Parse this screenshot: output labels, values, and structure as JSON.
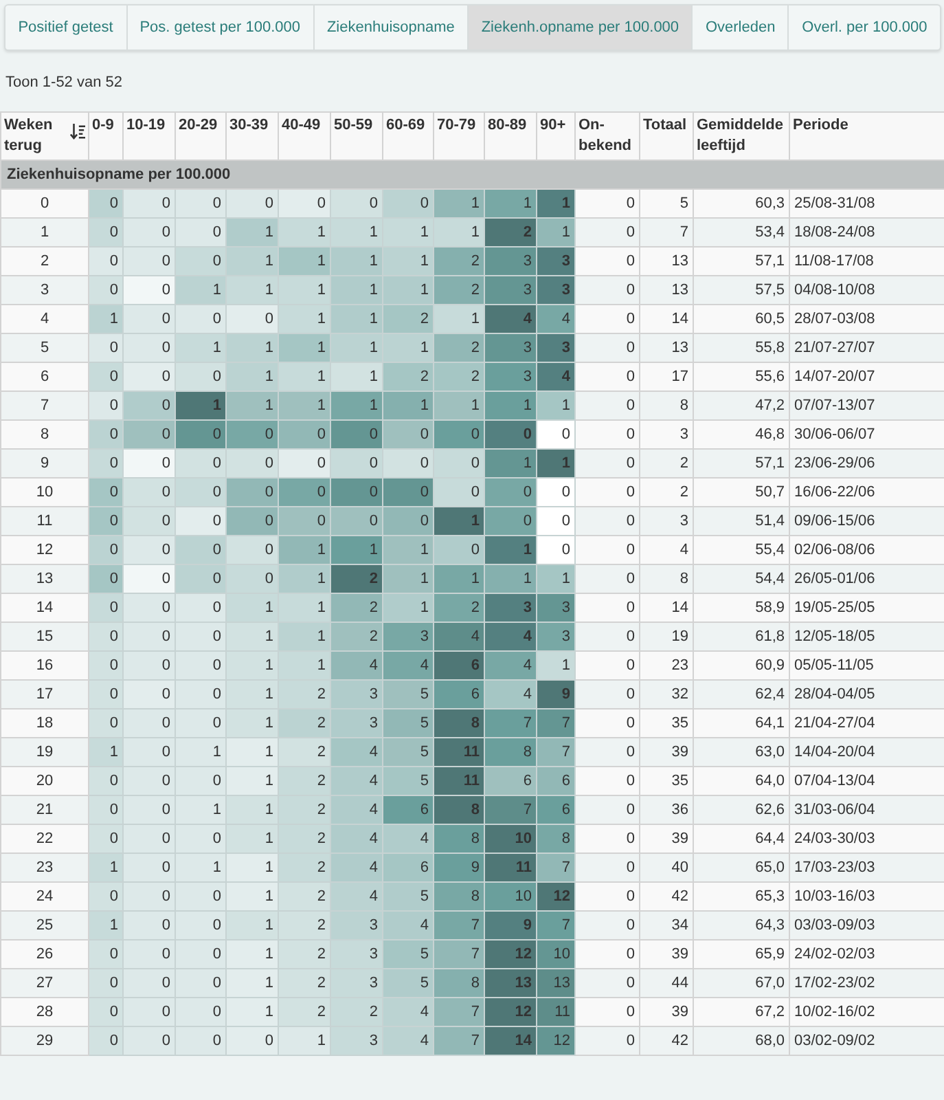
{
  "tabs": [
    {
      "label": "Positief getest",
      "selected": false
    },
    {
      "label": "Pos. getest per 100.000",
      "selected": false
    },
    {
      "label": "Ziekenhuisopname",
      "selected": false
    },
    {
      "label": "Ziekenh.opname per 100.000",
      "selected": true
    },
    {
      "label": "Overleden",
      "selected": false
    },
    {
      "label": "Overl. per 100.000",
      "selected": false
    }
  ],
  "summary": "Toon 1-52 van 52",
  "table": {
    "columns": [
      {
        "label": "Weken terug",
        "kind": "sort"
      },
      {
        "label": "0-9",
        "kind": "plain"
      },
      {
        "label": "10-19",
        "kind": "plain"
      },
      {
        "label": "20-29",
        "kind": "plain"
      },
      {
        "label": "30-39",
        "kind": "plain"
      },
      {
        "label": "40-49",
        "kind": "plain"
      },
      {
        "label": "50-59",
        "kind": "plain"
      },
      {
        "label": "60-69",
        "kind": "plain"
      },
      {
        "label": "70-79",
        "kind": "plain"
      },
      {
        "label": "80-89",
        "kind": "plain"
      },
      {
        "label": "90+",
        "kind": "plain"
      },
      {
        "label": "On-bekend",
        "kind": "plain"
      },
      {
        "label": "Totaal",
        "kind": "plain"
      },
      {
        "label": "Gemiddelde leeftijd",
        "kind": "plain"
      },
      {
        "label": "Periode",
        "kind": "plain"
      }
    ],
    "group": "Ziekenhuisopname per 100.000",
    "rows": [
      {
        "cells": [
          {
            "value": "0"
          },
          {
            "value": "0",
            "color": "#bbd3d2"
          },
          {
            "value": "0",
            "color": "#dde9e9"
          },
          {
            "value": "0",
            "color": "#dde9e9"
          },
          {
            "value": "0",
            "color": "#dde9e9"
          },
          {
            "value": "0",
            "color": "#e3eded"
          },
          {
            "value": "0",
            "color": "#d2e2e1"
          },
          {
            "value": "0",
            "color": "#bbd3d2"
          },
          {
            "value": "1",
            "color": "#92b8b6"
          },
          {
            "value": "1",
            "color": "#78a8a5"
          },
          {
            "value": "1",
            "color": "#548080"
          },
          {
            "value": "0"
          },
          {
            "value": "5"
          },
          {
            "value": "60,3"
          },
          {
            "value": "25/08-31/08"
          }
        ]
      },
      {
        "cells": [
          {
            "value": "1"
          },
          {
            "value": "0",
            "color": "#c7dbda"
          },
          {
            "value": "0",
            "color": "#dde9e9"
          },
          {
            "value": "0",
            "color": "#dde9e9"
          },
          {
            "value": "1",
            "color": "#b0cccb"
          },
          {
            "value": "1",
            "color": "#c7dbda"
          },
          {
            "value": "1",
            "color": "#c7dbda"
          },
          {
            "value": "1",
            "color": "#c7dbda"
          },
          {
            "value": "1",
            "color": "#c7dbda"
          },
          {
            "value": "2",
            "color": "#4f7776"
          },
          {
            "value": "1",
            "color": "#92b8b6"
          },
          {
            "value": "0"
          },
          {
            "value": "7"
          },
          {
            "value": "53,4"
          },
          {
            "value": "18/08-24/08"
          }
        ]
      },
      {
        "cells": [
          {
            "value": "2"
          },
          {
            "value": "0",
            "color": "#dde9e9"
          },
          {
            "value": "0",
            "color": "#dde9e9"
          },
          {
            "value": "0",
            "color": "#c7dbda"
          },
          {
            "value": "1",
            "color": "#bbd3d2"
          },
          {
            "value": "1",
            "color": "#a5c6c4"
          },
          {
            "value": "1",
            "color": "#b0cccb"
          },
          {
            "value": "1",
            "color": "#bbd3d2"
          },
          {
            "value": "2",
            "color": "#85b0ae"
          },
          {
            "value": "3",
            "color": "#649693"
          },
          {
            "value": "3",
            "color": "#548080"
          },
          {
            "value": "0"
          },
          {
            "value": "13"
          },
          {
            "value": "57,1"
          },
          {
            "value": "11/08-17/08"
          }
        ]
      },
      {
        "cells": [
          {
            "value": "3"
          },
          {
            "value": "0",
            "color": "#d2e2e1"
          },
          {
            "value": "0",
            "color": "#f2f7f7"
          },
          {
            "value": "1",
            "color": "#bbd3d2"
          },
          {
            "value": "1",
            "color": "#c7dbda"
          },
          {
            "value": "1",
            "color": "#c7dbda"
          },
          {
            "value": "1",
            "color": "#b0cccb"
          },
          {
            "value": "1",
            "color": "#b0cccb"
          },
          {
            "value": "2",
            "color": "#85b0ae"
          },
          {
            "value": "3",
            "color": "#649693"
          },
          {
            "value": "3",
            "color": "#548080"
          },
          {
            "value": "0"
          },
          {
            "value": "13"
          },
          {
            "value": "57,5"
          },
          {
            "value": "04/08-10/08"
          }
        ]
      },
      {
        "cells": [
          {
            "value": "4"
          },
          {
            "value": "1",
            "color": "#bbd3d2"
          },
          {
            "value": "0",
            "color": "#dde9e9"
          },
          {
            "value": "0",
            "color": "#dde9e9"
          },
          {
            "value": "0",
            "color": "#e3eded"
          },
          {
            "value": "1",
            "color": "#c7dbda"
          },
          {
            "value": "1",
            "color": "#b0cccb"
          },
          {
            "value": "2",
            "color": "#a5c6c4"
          },
          {
            "value": "1",
            "color": "#c7dbda"
          },
          {
            "value": "4",
            "color": "#4f7776"
          },
          {
            "value": "4",
            "color": "#78a8a5"
          },
          {
            "value": "0"
          },
          {
            "value": "14"
          },
          {
            "value": "60,5"
          },
          {
            "value": "28/07-03/08"
          }
        ]
      },
      {
        "cells": [
          {
            "value": "5"
          },
          {
            "value": "0",
            "color": "#dde9e9"
          },
          {
            "value": "0",
            "color": "#dde9e9"
          },
          {
            "value": "1",
            "color": "#c7dbda"
          },
          {
            "value": "1",
            "color": "#bbd3d2"
          },
          {
            "value": "1",
            "color": "#a5c6c4"
          },
          {
            "value": "1",
            "color": "#bbd3d2"
          },
          {
            "value": "1",
            "color": "#bbd3d2"
          },
          {
            "value": "2",
            "color": "#92b8b6"
          },
          {
            "value": "3",
            "color": "#649693"
          },
          {
            "value": "3",
            "color": "#548080"
          },
          {
            "value": "0"
          },
          {
            "value": "13"
          },
          {
            "value": "55,8"
          },
          {
            "value": "21/07-27/07"
          }
        ]
      },
      {
        "cells": [
          {
            "value": "6"
          },
          {
            "value": "0",
            "color": "#c7dbda"
          },
          {
            "value": "0",
            "color": "#e3eded"
          },
          {
            "value": "0",
            "color": "#d2e2e1"
          },
          {
            "value": "1",
            "color": "#bbd3d2"
          },
          {
            "value": "1",
            "color": "#c7dbda"
          },
          {
            "value": "1",
            "color": "#d2e2e1"
          },
          {
            "value": "2",
            "color": "#a5c6c4"
          },
          {
            "value": "2",
            "color": "#a5c6c4"
          },
          {
            "value": "3",
            "color": "#6a9f9c"
          },
          {
            "value": "4",
            "color": "#548080"
          },
          {
            "value": "0"
          },
          {
            "value": "17"
          },
          {
            "value": "55,6"
          },
          {
            "value": "14/07-20/07"
          }
        ]
      },
      {
        "cells": [
          {
            "value": "7"
          },
          {
            "value": "0",
            "color": "#dde9e9"
          },
          {
            "value": "0",
            "color": "#b0cccb"
          },
          {
            "value": "1",
            "color": "#4f7776"
          },
          {
            "value": "1",
            "color": "#9fc0be"
          },
          {
            "value": "1",
            "color": "#9fc0be"
          },
          {
            "value": "1",
            "color": "#78a8a5"
          },
          {
            "value": "1",
            "color": "#85b0ae"
          },
          {
            "value": "1",
            "color": "#9fc0be"
          },
          {
            "value": "1",
            "color": "#6a9f9c"
          },
          {
            "value": "1",
            "color": "#a5c6c4"
          },
          {
            "value": "0"
          },
          {
            "value": "8"
          },
          {
            "value": "47,2"
          },
          {
            "value": "07/07-13/07"
          }
        ]
      },
      {
        "cells": [
          {
            "value": "8"
          },
          {
            "value": "0",
            "color": "#bbd3d2"
          },
          {
            "value": "0",
            "color": "#9fc0be"
          },
          {
            "value": "0",
            "color": "#649693"
          },
          {
            "value": "0",
            "color": "#78a8a5"
          },
          {
            "value": "0",
            "color": "#92b8b6"
          },
          {
            "value": "0",
            "color": "#649693"
          },
          {
            "value": "0",
            "color": "#9fc0be"
          },
          {
            "value": "0",
            "color": "#6a9f9c"
          },
          {
            "value": "0",
            "color": "#548080"
          },
          {
            "value": "0",
            "color": "#ffffff"
          },
          {
            "value": "0"
          },
          {
            "value": "3"
          },
          {
            "value": "46,8"
          },
          {
            "value": "30/06-06/07"
          }
        ]
      },
      {
        "cells": [
          {
            "value": "9"
          },
          {
            "value": "0",
            "color": "#c7dbda"
          },
          {
            "value": "0",
            "color": "#f2f7f7"
          },
          {
            "value": "0",
            "color": "#d2e2e1"
          },
          {
            "value": "0",
            "color": "#d2e2e1"
          },
          {
            "value": "0",
            "color": "#e3eded"
          },
          {
            "value": "0",
            "color": "#c7dbda"
          },
          {
            "value": "0",
            "color": "#d2e2e1"
          },
          {
            "value": "0",
            "color": "#c7dbda"
          },
          {
            "value": "1",
            "color": "#649693"
          },
          {
            "value": "1",
            "color": "#4f7776"
          },
          {
            "value": "0"
          },
          {
            "value": "2"
          },
          {
            "value": "57,1"
          },
          {
            "value": "23/06-29/06"
          }
        ]
      },
      {
        "cells": [
          {
            "value": "10"
          },
          {
            "value": "0",
            "color": "#a5c6c4"
          },
          {
            "value": "0",
            "color": "#d2e2e1"
          },
          {
            "value": "0",
            "color": "#c7dbda"
          },
          {
            "value": "0",
            "color": "#92b8b6"
          },
          {
            "value": "0",
            "color": "#78a8a5"
          },
          {
            "value": "0",
            "color": "#649693"
          },
          {
            "value": "0",
            "color": "#649693"
          },
          {
            "value": "0",
            "color": "#c7dbda"
          },
          {
            "value": "0",
            "color": "#78a8a5"
          },
          {
            "value": "0",
            "color": "#ffffff"
          },
          {
            "value": "0"
          },
          {
            "value": "2"
          },
          {
            "value": "50,7"
          },
          {
            "value": "16/06-22/06"
          }
        ]
      },
      {
        "cells": [
          {
            "value": "11"
          },
          {
            "value": "0",
            "color": "#a5c6c4"
          },
          {
            "value": "0",
            "color": "#d2e2e1"
          },
          {
            "value": "0",
            "color": "#e3eded"
          },
          {
            "value": "0",
            "color": "#92b8b6"
          },
          {
            "value": "0",
            "color": "#9fc0be"
          },
          {
            "value": "0",
            "color": "#9fc0be"
          },
          {
            "value": "0",
            "color": "#92b8b6"
          },
          {
            "value": "1",
            "color": "#4f7776"
          },
          {
            "value": "0",
            "color": "#78a8a5"
          },
          {
            "value": "0",
            "color": "#ffffff"
          },
          {
            "value": "0"
          },
          {
            "value": "3"
          },
          {
            "value": "51,4"
          },
          {
            "value": "09/06-15/06"
          }
        ]
      },
      {
        "cells": [
          {
            "value": "12"
          },
          {
            "value": "0",
            "color": "#bbd3d2"
          },
          {
            "value": "0",
            "color": "#dde9e9"
          },
          {
            "value": "0",
            "color": "#bbd3d2"
          },
          {
            "value": "0",
            "color": "#d2e2e1"
          },
          {
            "value": "1",
            "color": "#92b8b6"
          },
          {
            "value": "1",
            "color": "#6a9f9c"
          },
          {
            "value": "1",
            "color": "#9fc0be"
          },
          {
            "value": "0",
            "color": "#b0cccb"
          },
          {
            "value": "1",
            "color": "#548080"
          },
          {
            "value": "0",
            "color": "#ffffff"
          },
          {
            "value": "0"
          },
          {
            "value": "4"
          },
          {
            "value": "55,4"
          },
          {
            "value": "02/06-08/06"
          }
        ]
      },
      {
        "cells": [
          {
            "value": "13"
          },
          {
            "value": "0",
            "color": "#a5c6c4"
          },
          {
            "value": "0",
            "color": "#f2f7f7"
          },
          {
            "value": "0",
            "color": "#bbd3d2"
          },
          {
            "value": "0",
            "color": "#c7dbda"
          },
          {
            "value": "1",
            "color": "#b0cccb"
          },
          {
            "value": "2",
            "color": "#4f7776"
          },
          {
            "value": "1",
            "color": "#9fc0be"
          },
          {
            "value": "1",
            "color": "#78a8a5"
          },
          {
            "value": "1",
            "color": "#85b0ae"
          },
          {
            "value": "1",
            "color": "#a5c6c4"
          },
          {
            "value": "0"
          },
          {
            "value": "8"
          },
          {
            "value": "54,4"
          },
          {
            "value": "26/05-01/06"
          }
        ]
      },
      {
        "cells": [
          {
            "value": "14"
          },
          {
            "value": "0",
            "color": "#c7dbda"
          },
          {
            "value": "0",
            "color": "#dde9e9"
          },
          {
            "value": "0",
            "color": "#dde9e9"
          },
          {
            "value": "1",
            "color": "#c7dbda"
          },
          {
            "value": "1",
            "color": "#c7dbda"
          },
          {
            "value": "2",
            "color": "#92b8b6"
          },
          {
            "value": "1",
            "color": "#b0cccb"
          },
          {
            "value": "2",
            "color": "#78a8a5"
          },
          {
            "value": "3",
            "color": "#548080"
          },
          {
            "value": "3",
            "color": "#649693"
          },
          {
            "value": "0"
          },
          {
            "value": "14"
          },
          {
            "value": "58,9"
          },
          {
            "value": "19/05-25/05"
          }
        ]
      },
      {
        "cells": [
          {
            "value": "15"
          },
          {
            "value": "0",
            "color": "#d2e2e1"
          },
          {
            "value": "0",
            "color": "#dde9e9"
          },
          {
            "value": "0",
            "color": "#dde9e9"
          },
          {
            "value": "1",
            "color": "#d2e2e1"
          },
          {
            "value": "1",
            "color": "#bbd3d2"
          },
          {
            "value": "2",
            "color": "#9fc0be"
          },
          {
            "value": "3",
            "color": "#78a8a5"
          },
          {
            "value": "4",
            "color": "#5e8d8a"
          },
          {
            "value": "4",
            "color": "#548080"
          },
          {
            "value": "3",
            "color": "#78a8a5"
          },
          {
            "value": "0"
          },
          {
            "value": "19"
          },
          {
            "value": "61,8"
          },
          {
            "value": "12/05-18/05"
          }
        ]
      },
      {
        "cells": [
          {
            "value": "16"
          },
          {
            "value": "0",
            "color": "#d2e2e1"
          },
          {
            "value": "0",
            "color": "#dde9e9"
          },
          {
            "value": "0",
            "color": "#dde9e9"
          },
          {
            "value": "1",
            "color": "#d2e2e1"
          },
          {
            "value": "1",
            "color": "#c7dbda"
          },
          {
            "value": "4",
            "color": "#92b8b6"
          },
          {
            "value": "4",
            "color": "#78a8a5"
          },
          {
            "value": "6",
            "color": "#4f7776"
          },
          {
            "value": "4",
            "color": "#78a8a5"
          },
          {
            "value": "1",
            "color": "#c7dbda"
          },
          {
            "value": "0"
          },
          {
            "value": "23"
          },
          {
            "value": "60,9"
          },
          {
            "value": "05/05-11/05"
          }
        ]
      },
      {
        "cells": [
          {
            "value": "17"
          },
          {
            "value": "0",
            "color": "#d2e2e1"
          },
          {
            "value": "0",
            "color": "#e3eded"
          },
          {
            "value": "0",
            "color": "#dde9e9"
          },
          {
            "value": "1",
            "color": "#d2e2e1"
          },
          {
            "value": "2",
            "color": "#c7dbda"
          },
          {
            "value": "3",
            "color": "#b0cccb"
          },
          {
            "value": "5",
            "color": "#9fc0be"
          },
          {
            "value": "6",
            "color": "#6a9f9c"
          },
          {
            "value": "4",
            "color": "#a5c6c4"
          },
          {
            "value": "9",
            "color": "#4f7776"
          },
          {
            "value": "0"
          },
          {
            "value": "32"
          },
          {
            "value": "62,4"
          },
          {
            "value": "28/04-04/05"
          }
        ]
      },
      {
        "cells": [
          {
            "value": "18"
          },
          {
            "value": "0",
            "color": "#d2e2e1"
          },
          {
            "value": "0",
            "color": "#dde9e9"
          },
          {
            "value": "0",
            "color": "#dde9e9"
          },
          {
            "value": "1",
            "color": "#d2e2e1"
          },
          {
            "value": "2",
            "color": "#bbd3d2"
          },
          {
            "value": "3",
            "color": "#b0cccb"
          },
          {
            "value": "5",
            "color": "#92b8b6"
          },
          {
            "value": "8",
            "color": "#4f7776"
          },
          {
            "value": "7",
            "color": "#6a9f9c"
          },
          {
            "value": "7",
            "color": "#649693"
          },
          {
            "value": "0"
          },
          {
            "value": "35"
          },
          {
            "value": "64,1"
          },
          {
            "value": "21/04-27/04"
          }
        ]
      },
      {
        "cells": [
          {
            "value": "19"
          },
          {
            "value": "1",
            "color": "#c7dbda"
          },
          {
            "value": "0",
            "color": "#dde9e9"
          },
          {
            "value": "1",
            "color": "#dde9e9"
          },
          {
            "value": "1",
            "color": "#e3eded"
          },
          {
            "value": "2",
            "color": "#d2e2e1"
          },
          {
            "value": "4",
            "color": "#a5c6c4"
          },
          {
            "value": "5",
            "color": "#9fc0be"
          },
          {
            "value": "11",
            "color": "#4f7776"
          },
          {
            "value": "8",
            "color": "#6a9f9c"
          },
          {
            "value": "7",
            "color": "#92b8b6"
          },
          {
            "value": "0"
          },
          {
            "value": "39"
          },
          {
            "value": "63,0"
          },
          {
            "value": "14/04-20/04"
          }
        ]
      },
      {
        "cells": [
          {
            "value": "20"
          },
          {
            "value": "0",
            "color": "#d2e2e1"
          },
          {
            "value": "0",
            "color": "#dde9e9"
          },
          {
            "value": "0",
            "color": "#dde9e9"
          },
          {
            "value": "1",
            "color": "#e3eded"
          },
          {
            "value": "2",
            "color": "#c7dbda"
          },
          {
            "value": "4",
            "color": "#b0cccb"
          },
          {
            "value": "5",
            "color": "#a5c6c4"
          },
          {
            "value": "11",
            "color": "#4f7776"
          },
          {
            "value": "6",
            "color": "#9fc0be"
          },
          {
            "value": "6",
            "color": "#92b8b6"
          },
          {
            "value": "0"
          },
          {
            "value": "35"
          },
          {
            "value": "64,0"
          },
          {
            "value": "07/04-13/04"
          }
        ]
      },
      {
        "cells": [
          {
            "value": "21"
          },
          {
            "value": "0",
            "color": "#d2e2e1"
          },
          {
            "value": "0",
            "color": "#dde9e9"
          },
          {
            "value": "1",
            "color": "#dde9e9"
          },
          {
            "value": "1",
            "color": "#d2e2e1"
          },
          {
            "value": "2",
            "color": "#c7dbda"
          },
          {
            "value": "4",
            "color": "#b0cccb"
          },
          {
            "value": "6",
            "color": "#6a9f9c"
          },
          {
            "value": "8",
            "color": "#4f7776"
          },
          {
            "value": "7",
            "color": "#5e8d8a"
          },
          {
            "value": "6",
            "color": "#6a9f9c"
          },
          {
            "value": "0"
          },
          {
            "value": "36"
          },
          {
            "value": "62,6"
          },
          {
            "value": "31/03-06/04"
          }
        ]
      },
      {
        "cells": [
          {
            "value": "22"
          },
          {
            "value": "0",
            "color": "#d2e2e1"
          },
          {
            "value": "0",
            "color": "#dde9e9"
          },
          {
            "value": "0",
            "color": "#dde9e9"
          },
          {
            "value": "1",
            "color": "#d2e2e1"
          },
          {
            "value": "2",
            "color": "#c7dbda"
          },
          {
            "value": "4",
            "color": "#b0cccb"
          },
          {
            "value": "4",
            "color": "#b0cccb"
          },
          {
            "value": "8",
            "color": "#6a9f9c"
          },
          {
            "value": "10",
            "color": "#4f7776"
          },
          {
            "value": "8",
            "color": "#78a8a5"
          },
          {
            "value": "0"
          },
          {
            "value": "39"
          },
          {
            "value": "64,4"
          },
          {
            "value": "24/03-30/03"
          }
        ]
      },
      {
        "cells": [
          {
            "value": "23"
          },
          {
            "value": "1",
            "color": "#c7dbda"
          },
          {
            "value": "0",
            "color": "#dde9e9"
          },
          {
            "value": "1",
            "color": "#dde9e9"
          },
          {
            "value": "1",
            "color": "#e3eded"
          },
          {
            "value": "2",
            "color": "#c7dbda"
          },
          {
            "value": "4",
            "color": "#b0cccb"
          },
          {
            "value": "6",
            "color": "#a5c6c4"
          },
          {
            "value": "9",
            "color": "#6a9f9c"
          },
          {
            "value": "11",
            "color": "#4f7776"
          },
          {
            "value": "7",
            "color": "#92b8b6"
          },
          {
            "value": "0"
          },
          {
            "value": "40"
          },
          {
            "value": "65,0"
          },
          {
            "value": "17/03-23/03"
          }
        ]
      },
      {
        "cells": [
          {
            "value": "24"
          },
          {
            "value": "0",
            "color": "#d2e2e1"
          },
          {
            "value": "0",
            "color": "#dde9e9"
          },
          {
            "value": "0",
            "color": "#dde9e9"
          },
          {
            "value": "1",
            "color": "#e3eded"
          },
          {
            "value": "2",
            "color": "#d2e2e1"
          },
          {
            "value": "4",
            "color": "#bbd3d2"
          },
          {
            "value": "5",
            "color": "#b0cccb"
          },
          {
            "value": "8",
            "color": "#78a8a5"
          },
          {
            "value": "10",
            "color": "#6a9f9c"
          },
          {
            "value": "12",
            "color": "#4f7776"
          },
          {
            "value": "0"
          },
          {
            "value": "42"
          },
          {
            "value": "65,3"
          },
          {
            "value": "10/03-16/03"
          }
        ]
      },
      {
        "cells": [
          {
            "value": "25"
          },
          {
            "value": "1",
            "color": "#c7dbda"
          },
          {
            "value": "0",
            "color": "#dde9e9"
          },
          {
            "value": "0",
            "color": "#dde9e9"
          },
          {
            "value": "1",
            "color": "#d2e2e1"
          },
          {
            "value": "2",
            "color": "#d2e2e1"
          },
          {
            "value": "3",
            "color": "#bbd3d2"
          },
          {
            "value": "4",
            "color": "#b0cccb"
          },
          {
            "value": "7",
            "color": "#78a8a5"
          },
          {
            "value": "9",
            "color": "#548080"
          },
          {
            "value": "7",
            "color": "#6a9f9c"
          },
          {
            "value": "0"
          },
          {
            "value": "34"
          },
          {
            "value": "64,3"
          },
          {
            "value": "03/03-09/03"
          }
        ]
      },
      {
        "cells": [
          {
            "value": "26"
          },
          {
            "value": "0",
            "color": "#d2e2e1"
          },
          {
            "value": "0",
            "color": "#dde9e9"
          },
          {
            "value": "0",
            "color": "#dde9e9"
          },
          {
            "value": "1",
            "color": "#e3eded"
          },
          {
            "value": "2",
            "color": "#d2e2e1"
          },
          {
            "value": "3",
            "color": "#c7dbda"
          },
          {
            "value": "5",
            "color": "#a5c6c4"
          },
          {
            "value": "7",
            "color": "#92b8b6"
          },
          {
            "value": "12",
            "color": "#4f7776"
          },
          {
            "value": "10",
            "color": "#649693"
          },
          {
            "value": "0"
          },
          {
            "value": "39"
          },
          {
            "value": "65,9"
          },
          {
            "value": "24/02-02/03"
          }
        ]
      },
      {
        "cells": [
          {
            "value": "27"
          },
          {
            "value": "0",
            "color": "#d2e2e1"
          },
          {
            "value": "0",
            "color": "#dde9e9"
          },
          {
            "value": "0",
            "color": "#dde9e9"
          },
          {
            "value": "1",
            "color": "#e3eded"
          },
          {
            "value": "2",
            "color": "#d2e2e1"
          },
          {
            "value": "3",
            "color": "#c7dbda"
          },
          {
            "value": "5",
            "color": "#b0cccb"
          },
          {
            "value": "8",
            "color": "#85b0ae"
          },
          {
            "value": "13",
            "color": "#4f7776"
          },
          {
            "value": "13",
            "color": "#5e8d8a"
          },
          {
            "value": "0"
          },
          {
            "value": "44"
          },
          {
            "value": "67,0"
          },
          {
            "value": "17/02-23/02"
          }
        ]
      },
      {
        "cells": [
          {
            "value": "28"
          },
          {
            "value": "0",
            "color": "#d2e2e1"
          },
          {
            "value": "0",
            "color": "#dde9e9"
          },
          {
            "value": "0",
            "color": "#dde9e9"
          },
          {
            "value": "1",
            "color": "#e3eded"
          },
          {
            "value": "2",
            "color": "#d2e2e1"
          },
          {
            "value": "2",
            "color": "#c7dbda"
          },
          {
            "value": "4",
            "color": "#bbd3d2"
          },
          {
            "value": "7",
            "color": "#92b8b6"
          },
          {
            "value": "12",
            "color": "#4f7776"
          },
          {
            "value": "11",
            "color": "#5e8d8a"
          },
          {
            "value": "0"
          },
          {
            "value": "39"
          },
          {
            "value": "67,2"
          },
          {
            "value": "10/02-16/02"
          }
        ]
      },
      {
        "cells": [
          {
            "value": "29"
          },
          {
            "value": "0",
            "color": "#d2e2e1"
          },
          {
            "value": "0",
            "color": "#dde9e9"
          },
          {
            "value": "0",
            "color": "#dde9e9"
          },
          {
            "value": "0",
            "color": "#e3eded"
          },
          {
            "value": "1",
            "color": "#dde9e9"
          },
          {
            "value": "3",
            "color": "#c7dbda"
          },
          {
            "value": "4",
            "color": "#bbd3d2"
          },
          {
            "value": "7",
            "color": "#92b8b6"
          },
          {
            "value": "14",
            "color": "#4f7776"
          },
          {
            "value": "12",
            "color": "#649693"
          },
          {
            "value": "0"
          },
          {
            "value": "42"
          },
          {
            "value": "68,0"
          },
          {
            "value": "03/02-09/02"
          }
        ]
      }
    ]
  }
}
